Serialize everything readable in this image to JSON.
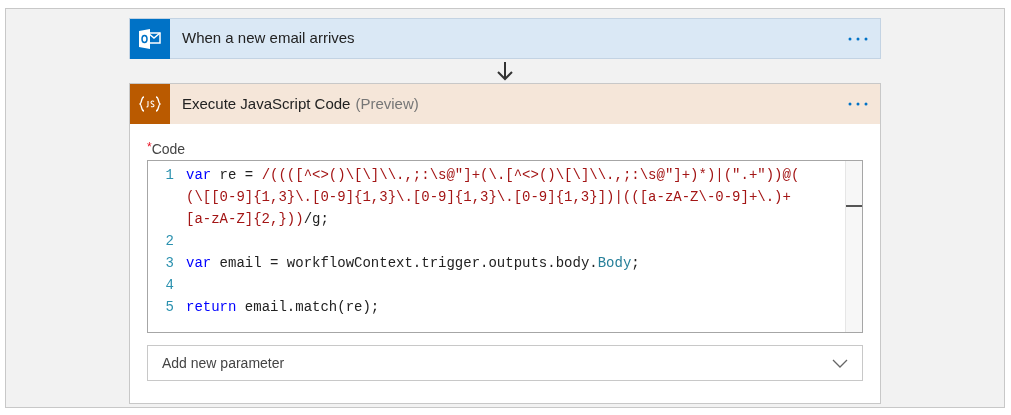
{
  "trigger": {
    "title": "When a new email arrives"
  },
  "action": {
    "title": "Execute JavaScript Code",
    "tag": "(Preview)",
    "field": {
      "required_mark": "*",
      "label": "Code",
      "lines": [
        {
          "number": "1",
          "rows": [
            {
              "tokens": [
                {
                  "kind": "keyword",
                  "text": "var"
                },
                {
                  "kind": "plain",
                  "text": " re = "
                },
                {
                  "kind": "regex",
                  "text": "/((([^<>()\\[\\]\\\\.,;:\\s@\"]+(\\.[^<>()\\[\\]\\\\.,;:\\s@\"]+)*)|(\".+\"))@("
                }
              ]
            },
            {
              "tokens": [
                {
                  "kind": "regex",
                  "text": "(\\[[0-9]{1,3}\\.[0-9]{1,3}\\.[0-9]{1,3}\\.[0-9]{1,3}])|(([a-zA-Z\\-0-9]+\\.)+"
                }
              ]
            },
            {
              "tokens": [
                {
                  "kind": "regex",
                  "text": "[a-zA-Z]{2,}))"
                },
                {
                  "kind": "plain",
                  "text": "/g;"
                }
              ]
            }
          ]
        },
        {
          "number": "2"
        },
        {
          "number": "3",
          "rows": [
            {
              "tokens": [
                {
                  "kind": "keyword",
                  "text": "var"
                },
                {
                  "kind": "plain",
                  "text": " email = workflowContext.trigger.outputs.body."
                },
                {
                  "kind": "property",
                  "text": "Body"
                },
                {
                  "kind": "plain",
                  "text": ";"
                }
              ]
            }
          ]
        },
        {
          "number": "4"
        },
        {
          "number": "5",
          "rows": [
            {
              "tokens": [
                {
                  "kind": "keyword",
                  "text": "return"
                },
                {
                  "kind": "plain",
                  "text": " email.match(re);"
                }
              ]
            }
          ]
        }
      ]
    },
    "parameter_dropdown": {
      "placeholder": "Add new parameter"
    }
  }
}
